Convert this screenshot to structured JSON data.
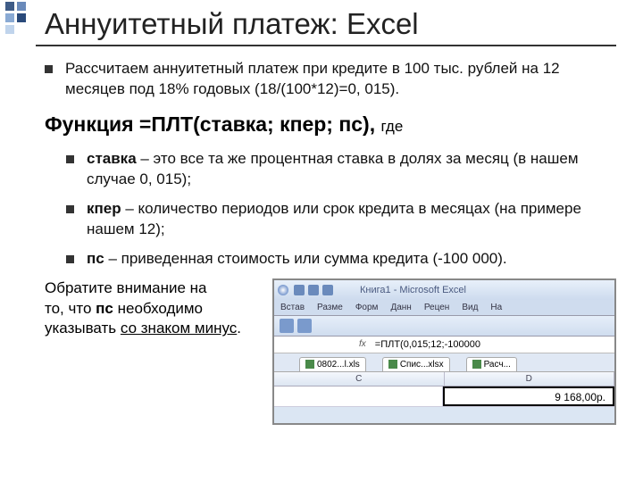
{
  "title": "Аннуитетный платеж: Excel",
  "intro": "Рассчитаем аннуитетный платеж при кредите в 100 тыс. рублей на 12 месяцев под 18% годовых (18/(100*12)=0, 015).",
  "func_heading_main": "Функция =ПЛТ(ставка; кпер; пс), ",
  "func_heading_small": "где",
  "items": [
    {
      "term": "ставка",
      "desc": " – это все та же процентная ставка в долях за месяц (в нашем случае 0, 015);"
    },
    {
      "term": "кпер",
      "desc": " – количество периодов или срок кредита в месяцах (на примере нашем 12);"
    },
    {
      "term": "пс",
      "desc": " – приведенная стоимость или сумма кредита (-100 000)."
    }
  ],
  "note_line1": "Обратите внимание на",
  "note_line2": "то, что ",
  "note_term": "пс",
  "note_line2b": " необходимо",
  "note_line3a": "указывать ",
  "note_line3u": "со знаком минус",
  "note_line3b": ".",
  "excel": {
    "window_title": "Книга1 - Microsoft Excel",
    "menu": [
      "Встав",
      "Разме",
      "Форм",
      "Данн",
      "Рецен",
      "Вид",
      "На"
    ],
    "fx_label": "fx",
    "formula": "=ПЛТ(0,015;12;-100000",
    "sheets": [
      "0802...l.xls",
      "Спис...xlsx",
      "Расч..."
    ],
    "cols": [
      "C",
      "D"
    ],
    "cell_value": "9 168,00р."
  }
}
